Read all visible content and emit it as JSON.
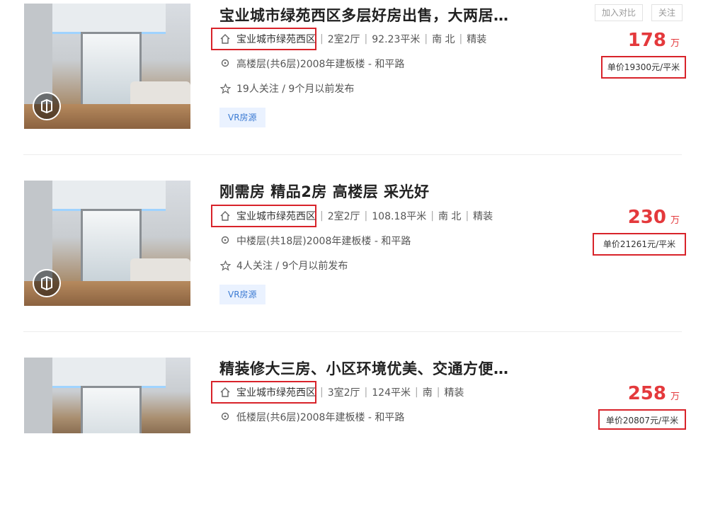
{
  "top_actions": {
    "compare_label": "加入对比",
    "follow_label": "关注"
  },
  "listings": [
    {
      "title": "宝业城市绿苑西区多层好房出售，大两居…",
      "community": "宝业城市绿苑西区",
      "specs": [
        "2室2厅",
        "92.23平米",
        "南 北",
        "精装"
      ],
      "floor_info": "高楼层(共6层)2008年建板楼 - 和平路",
      "follow_info": "19人关注 / 9个月以前发布",
      "tag": "VR房源",
      "price": "178",
      "price_unit": "万",
      "unit_price": "单价19300元/平米"
    },
    {
      "title": "刚需房 精品2房 高楼层 采光好",
      "community": "宝业城市绿苑西区",
      "specs": [
        "2室2厅",
        "108.18平米",
        "南 北",
        "精装"
      ],
      "floor_info": "中楼层(共18层)2008年建板楼 - 和平路",
      "follow_info": "4人关注 / 9个月以前发布",
      "tag": "VR房源",
      "price": "230",
      "price_unit": "万",
      "unit_price": "单价21261元/平米"
    },
    {
      "title": "精装修大三房、小区环境优美、交通方便…",
      "community": "宝业城市绿苑西区",
      "specs": [
        "3室2厅",
        "124平米",
        "南",
        "精装"
      ],
      "floor_info": "低楼层(共6层)2008年建板楼 - 和平路",
      "price": "258",
      "price_unit": "万",
      "unit_price": "单价20807元/平米"
    }
  ],
  "icons": {
    "community": "house-icon",
    "location": "map-pin-icon",
    "follow": "star-icon",
    "vr": "vr-cube-icon"
  },
  "colors": {
    "price": "#e4393c",
    "highlight_box": "#d8232a",
    "tag_bg": "#eaf2ff",
    "tag_text": "#3c7bd3"
  }
}
